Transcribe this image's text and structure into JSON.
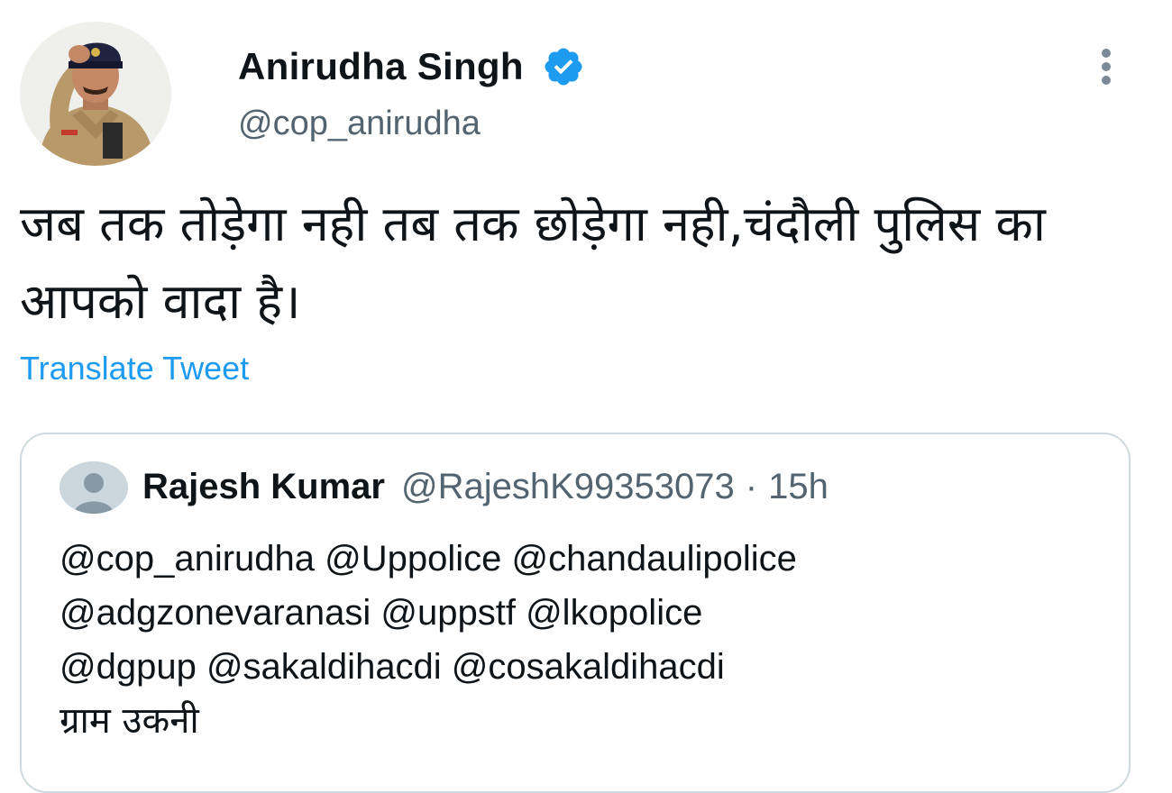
{
  "tweet": {
    "author": {
      "name": "Anirudha Singh",
      "handle": "@cop_anirudha",
      "verified": true
    },
    "text": "जब तक तोड़ेगा नही तब तक छोड़ेगा नही,चंदौली पुलिस का आपको वादा है।",
    "translate_label": "Translate Tweet"
  },
  "quoted_tweet": {
    "author": {
      "name": "Rajesh Kumar",
      "handle": "@RajeshK99353073"
    },
    "separator": "·",
    "time": "15h",
    "text_lines": [
      "@cop_anirudha @Uppolice @chandaulipolice",
      "@adgzonevaranasi @uppstf @lkopolice",
      "@dgpup @sakaldihacdi @cosakaldihacdi",
      "ग्राम उकनी"
    ]
  },
  "colors": {
    "accent": "#1d9bf0",
    "text_primary": "#0f1419",
    "text_secondary": "#536471",
    "border": "#cfd9de"
  },
  "icons": {
    "verified": "verified-badge-icon",
    "more": "more-vertical-icon",
    "default_avatar": "default-avatar-icon"
  }
}
